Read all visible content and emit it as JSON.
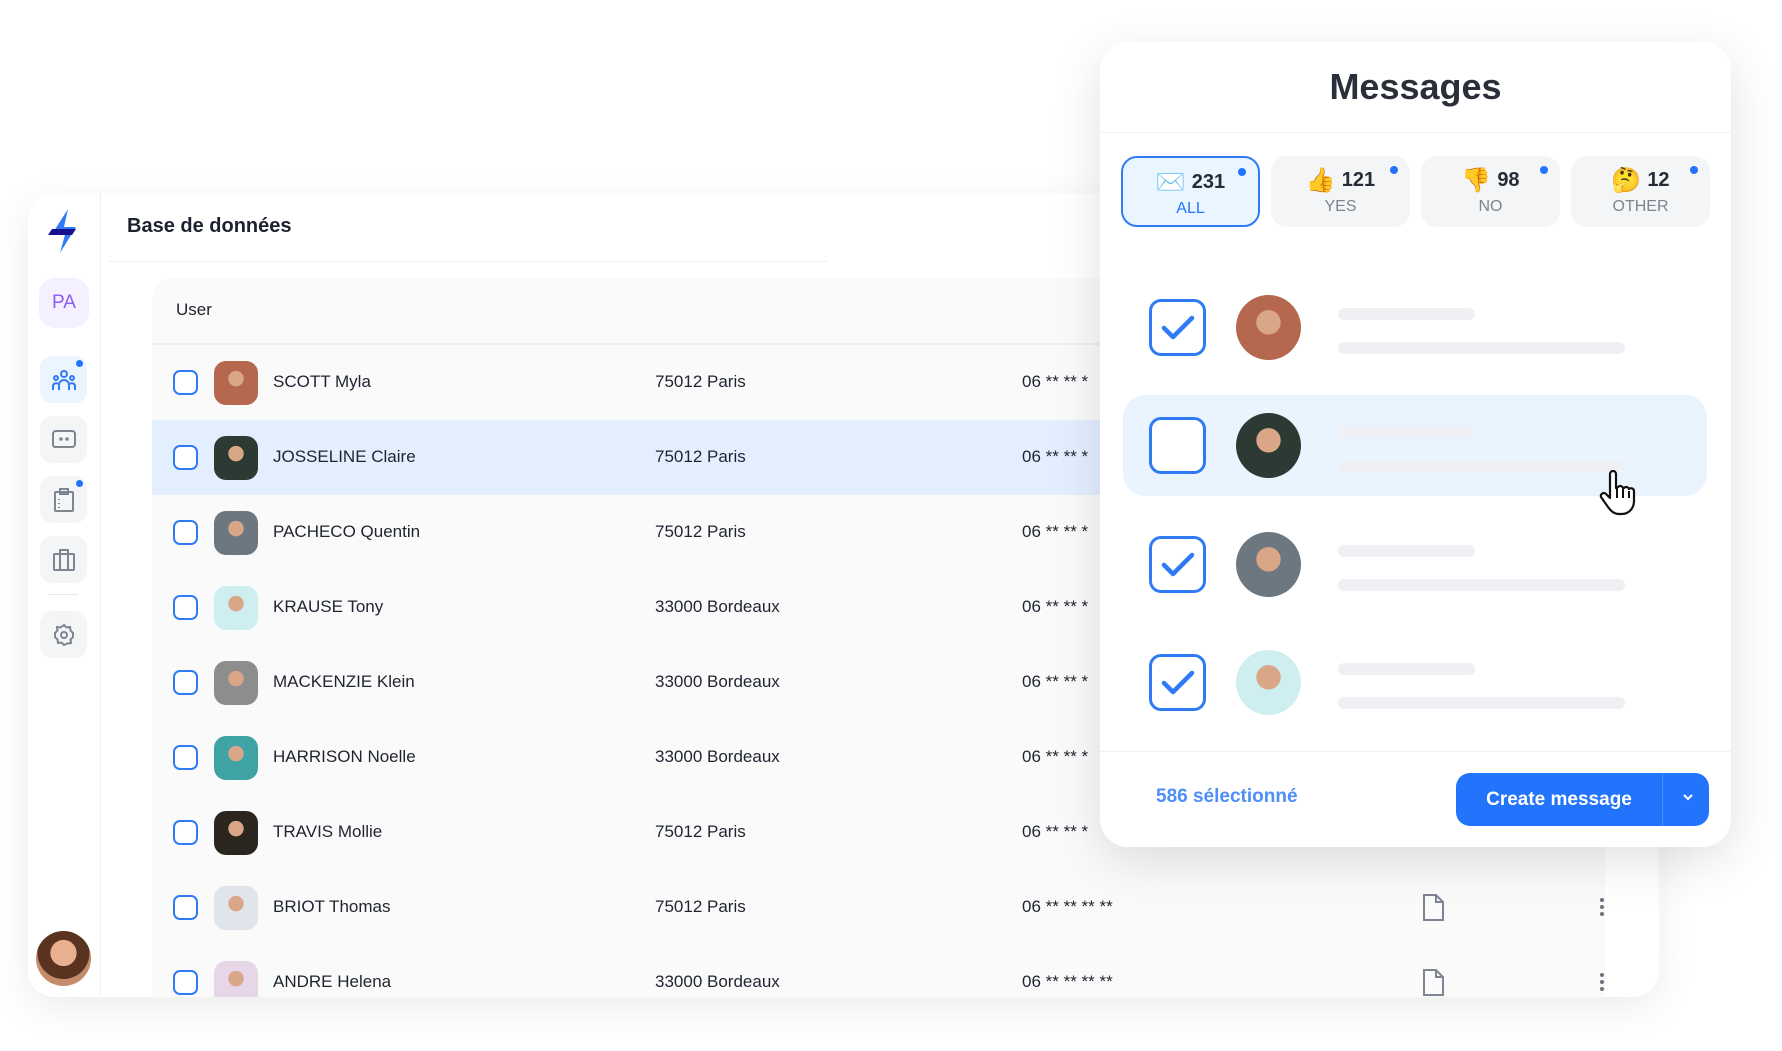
{
  "app": {
    "title": "Base de données",
    "user_initials": "PA"
  },
  "sidebar": {
    "items": [
      {
        "name": "users",
        "icon": "users-icon",
        "active": true,
        "badge": true
      },
      {
        "name": "messages",
        "icon": "chat-icon",
        "active": false,
        "badge": false
      },
      {
        "name": "clipboard",
        "icon": "clipboard-icon",
        "active": false,
        "badge": true
      },
      {
        "name": "briefcase",
        "icon": "briefcase-icon",
        "active": false,
        "badge": false
      },
      {
        "name": "settings",
        "icon": "gear-icon",
        "active": false,
        "badge": false
      }
    ]
  },
  "table": {
    "header": {
      "user": "User"
    },
    "rows": [
      {
        "name": "SCOTT Myla",
        "city": "75012 Paris",
        "phone": "06 ** ** *",
        "avatar": "#b5684d"
      },
      {
        "name": "JOSSELINE Claire",
        "city": "75012 Paris",
        "phone": "06 ** ** *",
        "avatar": "#2d3a33",
        "highlighted": true
      },
      {
        "name": "PACHECO Quentin",
        "city": "75012 Paris",
        "phone": "06 ** ** *",
        "avatar": "#6d7780"
      },
      {
        "name": "KRAUSE Tony",
        "city": "33000 Bordeaux",
        "phone": "06 ** ** *",
        "avatar": "#cfeef0"
      },
      {
        "name": "MACKENZIE Klein",
        "city": "33000 Bordeaux",
        "phone": "06 ** ** *",
        "avatar": "#8d8d8d"
      },
      {
        "name": "HARRISON Noelle",
        "city": "33000 Bordeaux",
        "phone": "06 ** ** *",
        "avatar": "#3fa3a6"
      },
      {
        "name": "TRAVIS Mollie",
        "city": "75012 Paris",
        "phone": "06 ** ** *",
        "avatar": "#2b2520"
      },
      {
        "name": "BRIOT Thomas",
        "city": "75012 Paris",
        "phone": "06 ** ** ** **",
        "avatar": "#dfe5ea"
      },
      {
        "name": "ANDRE Helena",
        "city": "33000 Bordeaux",
        "phone": "06 ** ** ** **",
        "avatar": "#e6d6e8"
      }
    ]
  },
  "messages": {
    "title": "Messages",
    "tabs": [
      {
        "emoji": "✉️",
        "count": "231",
        "label": "ALL",
        "active": true
      },
      {
        "emoji": "👍",
        "count": "121",
        "label": "YES",
        "active": false
      },
      {
        "emoji": "👎",
        "count": "98",
        "label": "NO",
        "active": false
      },
      {
        "emoji": "🤔",
        "count": "12",
        "label": "OTHER",
        "active": false
      }
    ],
    "list": [
      {
        "checked": true,
        "avatar": "#b5684d"
      },
      {
        "checked": false,
        "avatar": "#2d3a33",
        "highlighted": true
      },
      {
        "checked": true,
        "avatar": "#6d7780"
      },
      {
        "checked": true,
        "avatar": "#cfeef0"
      }
    ],
    "selected_count": "586 sélectionné",
    "create_label": "Create message"
  },
  "colors": {
    "accent": "#2174fb",
    "highlight": "#e3efff",
    "pa": "#8b5cf6"
  }
}
